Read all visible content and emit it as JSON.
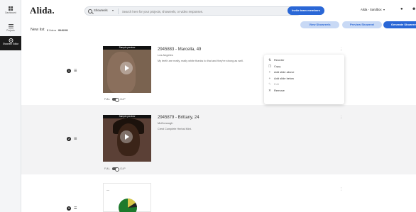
{
  "rail": {
    "items": [
      {
        "label": "Dashboard",
        "icon": "dashboard-icon"
      },
      {
        "label": "Projects",
        "icon": "projects-icon"
      },
      {
        "label": "Showreel Editor",
        "icon": "showreel-icon",
        "active": true
      }
    ]
  },
  "topbar": {
    "logo": "Alida.",
    "search_scope": "Showreels",
    "search_placeholder": "Search here for your projects, showreels, or video responses.",
    "invite_label": "Invite team members",
    "tenant": "Alida - Sandbox"
  },
  "actionbar": {
    "list_title": "New list",
    "count_number": "3",
    "count_label": "Videos",
    "duration": "00:02:01",
    "view_label": "View Showreels",
    "preview_label": "Preview Showreel",
    "generate_label": "Generate Showreel"
  },
  "slides": [
    {
      "index": "1",
      "thumb_header": "Sample preview",
      "full": "FULL",
      "clip": "CLIP",
      "title": "2945883 - Marcella, 49",
      "location": "Los Angeles",
      "quote": "My teeth are really, really white thanks to that and they're strong as well."
    },
    {
      "index": "2",
      "thumb_header": "Sample preview",
      "full": "FULL",
      "clip": "CLIP",
      "title": "2945879 - Brittany, 24",
      "location": "McDonough",
      "quote": "Crest Complete Herbal Mint."
    },
    {
      "index": "3",
      "thumb_header": "—"
    }
  ],
  "menu": {
    "items": [
      {
        "label": "Reorder",
        "icon": "reorder-icon",
        "disabled": false
      },
      {
        "label": "Copy",
        "icon": "copy-icon",
        "disabled": false
      },
      {
        "label": "Add slide above",
        "icon": "plus-icon",
        "disabled": false
      },
      {
        "label": "Add slide below",
        "icon": "plus-icon",
        "disabled": false
      },
      {
        "label": "Edit",
        "icon": "pencil-icon",
        "disabled": true
      },
      {
        "label": "Remove",
        "icon": "close-icon",
        "disabled": false
      }
    ]
  },
  "colors": {
    "accent": "#2a67d6",
    "accent_light": "#c8d9f5",
    "rail_active": "#1b1b1b"
  }
}
